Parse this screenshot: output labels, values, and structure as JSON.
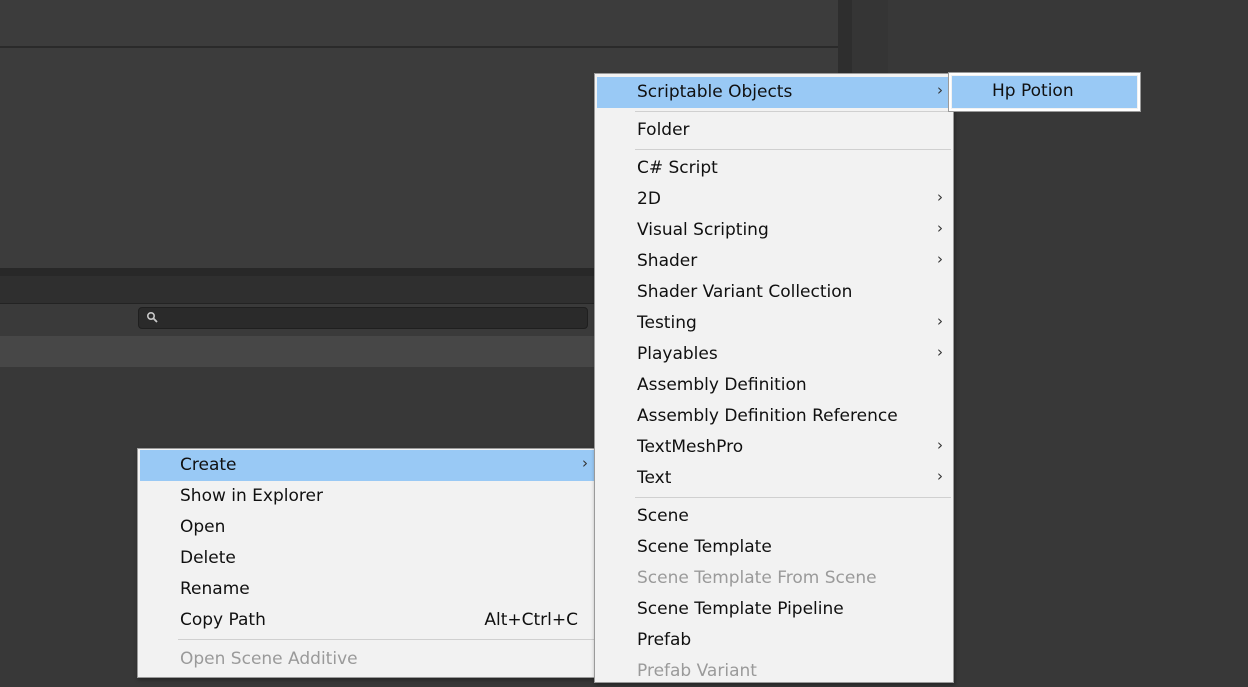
{
  "colors": {
    "menu_bg": "#f2f2f2",
    "menu_highlight": "#99c9f5",
    "editor_bg": "#383838",
    "disabled_text": "#9a9a9a"
  },
  "project_toolbar": {
    "search_icon": "magnifier-icon"
  },
  "context_menu": {
    "items": [
      {
        "label": "Create",
        "submenu": true,
        "highlighted": true
      },
      {
        "label": "Show in Explorer"
      },
      {
        "label": "Open"
      },
      {
        "label": "Delete"
      },
      {
        "label": "Rename"
      },
      {
        "label": "Copy Path",
        "shortcut": "Alt+Ctrl+C"
      },
      {
        "label": "Open Scene Additive",
        "disabled": true
      }
    ]
  },
  "create_menu": {
    "items": [
      {
        "label": "Scriptable Objects",
        "submenu": true,
        "highlighted": true
      },
      {
        "label": "Folder"
      },
      {
        "label": "C# Script"
      },
      {
        "label": "2D",
        "submenu": true
      },
      {
        "label": "Visual Scripting",
        "submenu": true
      },
      {
        "label": "Shader",
        "submenu": true
      },
      {
        "label": "Shader Variant Collection"
      },
      {
        "label": "Testing",
        "submenu": true
      },
      {
        "label": "Playables",
        "submenu": true
      },
      {
        "label": "Assembly Definition"
      },
      {
        "label": "Assembly Definition Reference"
      },
      {
        "label": "TextMeshPro",
        "submenu": true
      },
      {
        "label": "Text",
        "submenu": true
      },
      {
        "label": "Scene"
      },
      {
        "label": "Scene Template"
      },
      {
        "label": "Scene Template From Scene",
        "disabled": true
      },
      {
        "label": "Scene Template Pipeline"
      },
      {
        "label": "Prefab"
      },
      {
        "label": "Prefab Variant",
        "disabled": true
      }
    ]
  },
  "scriptable_objects_menu": {
    "items": [
      {
        "label": "Hp Potion",
        "highlighted": true
      }
    ]
  },
  "icons": {
    "submenu_arrow": "›"
  }
}
